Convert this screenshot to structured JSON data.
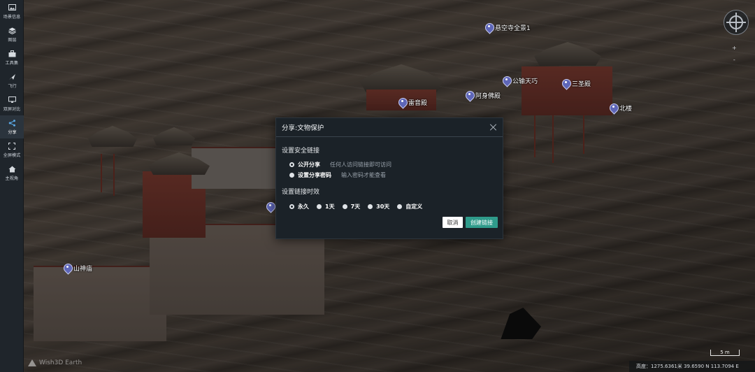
{
  "sidebar": {
    "items": [
      {
        "label": "场景信息",
        "icon": "photo-icon"
      },
      {
        "label": "图层",
        "icon": "layers-icon"
      },
      {
        "label": "工具集",
        "icon": "toolbox-icon"
      },
      {
        "label": "飞行",
        "icon": "plane-icon"
      },
      {
        "label": "双屏对比",
        "icon": "monitor-icon"
      },
      {
        "label": "分享",
        "icon": "share-icon",
        "active": true
      },
      {
        "label": "全屏模式",
        "icon": "fullscreen-icon"
      },
      {
        "label": "主视角",
        "icon": "home-icon"
      }
    ]
  },
  "pois": [
    {
      "label": "悬空寺全景1"
    },
    {
      "label": "公输天巧"
    },
    {
      "label": "三圣殿"
    },
    {
      "label": "雷音殿"
    },
    {
      "label": "阿身佛殿"
    },
    {
      "label": "北楼"
    },
    {
      "label": ""
    },
    {
      "label": "山神庙"
    }
  ],
  "compass": {
    "icon": "compass-icon"
  },
  "zoom": {
    "plus": "+",
    "minus": "-"
  },
  "logo": {
    "text": "Wish3D Earth"
  },
  "scale": {
    "label": "5 m"
  },
  "status": {
    "text": "高度：1275.6361米 39.6590 N 113.7094 E"
  },
  "modal": {
    "title": "分享:文物保护",
    "security_section": "设置安全链接",
    "public_option": "公开分享",
    "public_hint": "任何人访问链接即可访问",
    "password_option": "设置分享密码",
    "password_hint": "输入密码才能查看",
    "validity_section": "设置链接时效",
    "validity_options": [
      "永久",
      "1天",
      "7天",
      "30天",
      "自定义"
    ],
    "selected_validity": "永久",
    "cancel_label": "取消",
    "create_label": "创建链接"
  }
}
